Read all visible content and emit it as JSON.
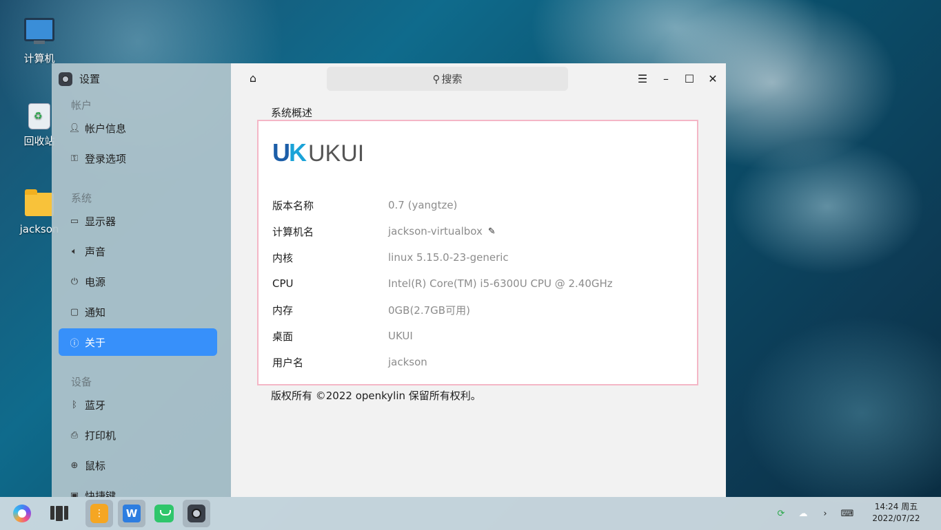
{
  "desktop": {
    "icons": [
      {
        "label": "计算机"
      },
      {
        "label": "回收站"
      },
      {
        "label": "jackson"
      }
    ]
  },
  "settings": {
    "app_title": "设置",
    "sidebar": {
      "groups": [
        {
          "label": "帐户",
          "items": [
            {
              "label": "帐户信息",
              "icon": "user-icon"
            },
            {
              "label": "登录选项",
              "icon": "key-icon"
            }
          ]
        },
        {
          "label": "系统",
          "items": [
            {
              "label": "显示器",
              "icon": "display-icon"
            },
            {
              "label": "声音",
              "icon": "speaker-icon"
            },
            {
              "label": "电源",
              "icon": "power-icon"
            },
            {
              "label": "通知",
              "icon": "notification-icon"
            },
            {
              "label": "关于",
              "icon": "info-icon"
            }
          ]
        },
        {
          "label": "设备",
          "items": [
            {
              "label": "蓝牙",
              "icon": "bluetooth-icon"
            },
            {
              "label": "打印机",
              "icon": "printer-icon"
            },
            {
              "label": "鼠标",
              "icon": "mouse-icon"
            },
            {
              "label": "快捷键",
              "icon": "keyboard-icon"
            }
          ]
        }
      ],
      "active_item": "关于"
    },
    "search_placeholder": "搜索",
    "section_title": "系统概述",
    "logo": {
      "mark": "UK",
      "text": "UKUI"
    },
    "info": [
      {
        "key": "版本名称",
        "value": "0.7 (yangtze)"
      },
      {
        "key": "计算机名",
        "value": "jackson-virtualbox"
      },
      {
        "key": "内核",
        "value": "linux 5.15.0-23-generic"
      },
      {
        "key": "CPU",
        "value": "Intel(R) Core(TM) i5-6300U CPU @ 2.40GHz"
      },
      {
        "key": "内存",
        "value": "0GB(2.7GB可用)"
      },
      {
        "key": "桌面",
        "value": "UKUI"
      },
      {
        "key": "用户名",
        "value": "jackson"
      }
    ],
    "copyright": "版权所有 ©2022 openkylin 保留所有权利。",
    "accent_color": "#3790fa",
    "highlight_border_color": "#f4b6c6"
  },
  "taskbar": {
    "clock_time": "14:24 周五",
    "clock_date": "2022/07/22"
  }
}
